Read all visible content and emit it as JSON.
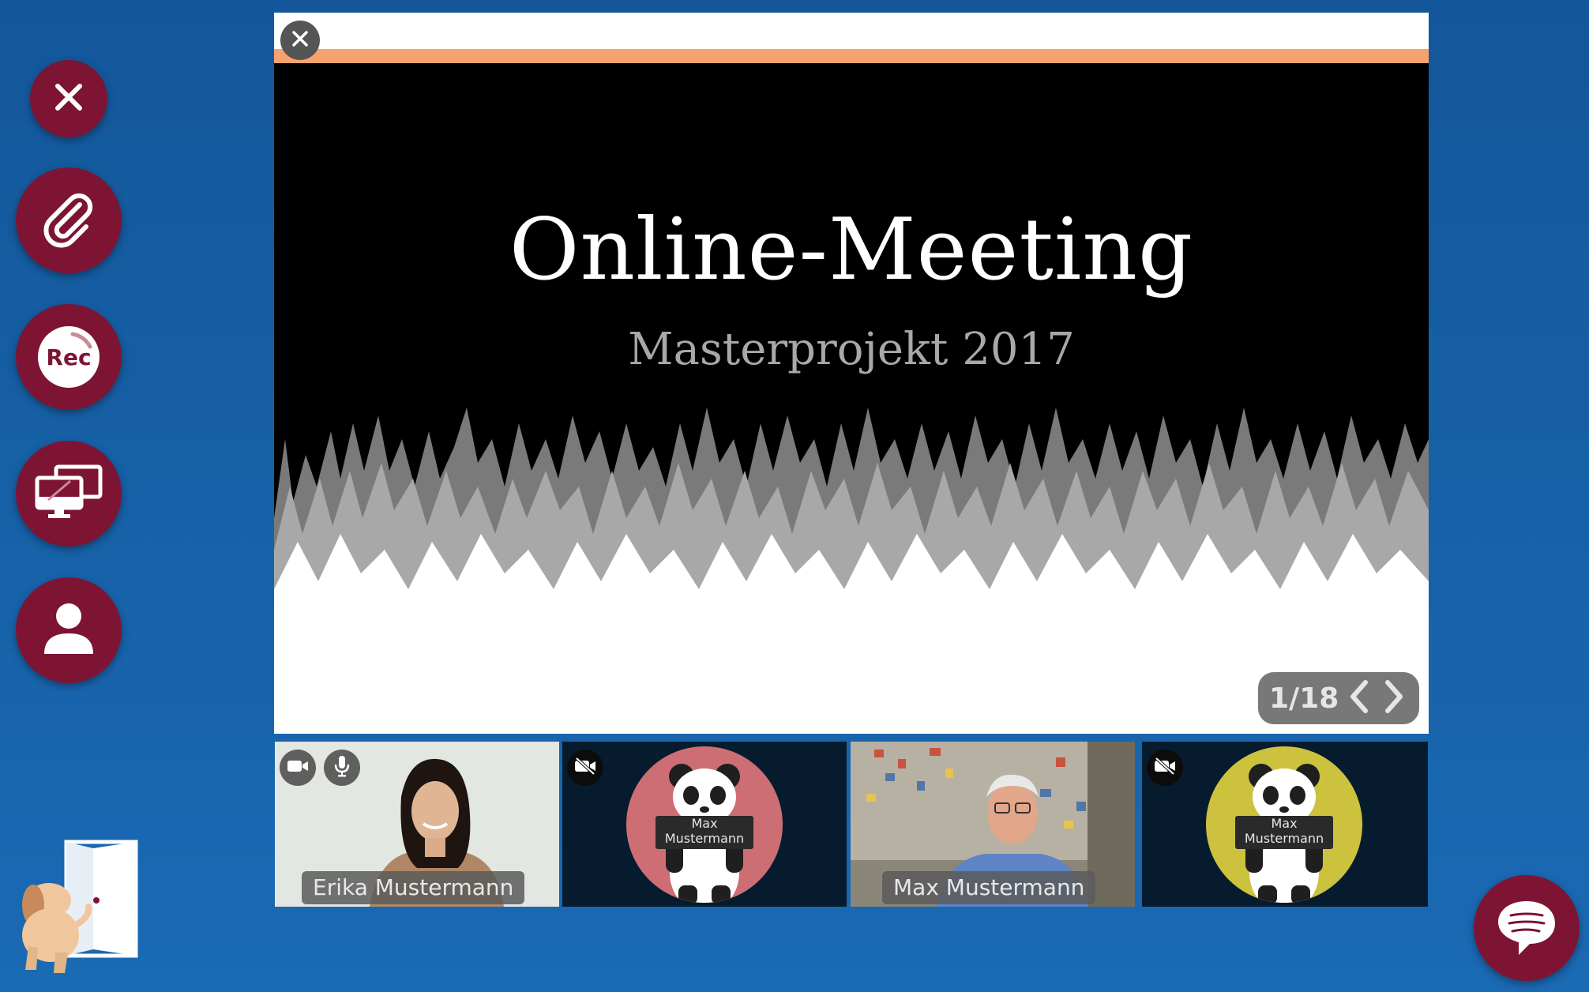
{
  "toolbar": {
    "items": [
      {
        "name": "close",
        "icon": "close-icon"
      },
      {
        "name": "attachments",
        "icon": "paperclip-icon"
      },
      {
        "name": "record",
        "icon": "record-icon",
        "label": "Rec"
      },
      {
        "name": "screen-share",
        "icon": "monitors-icon"
      },
      {
        "name": "participants",
        "icon": "person-icon"
      }
    ]
  },
  "exit": {
    "icon": "dog-exit-door-icon"
  },
  "slide": {
    "title": "Online-Meeting",
    "subtitle": "Masterprojekt 2017",
    "page_indicator": "1/18",
    "accent_color": "#f7a36e"
  },
  "participants": [
    {
      "name": "Erika Mustermann",
      "type": "video",
      "camera": "on",
      "mic": "on"
    },
    {
      "name": "Max Mustermann",
      "type": "avatar",
      "camera": "off",
      "avatar_color": "#cd6e74"
    },
    {
      "name": "Max Mustermann",
      "type": "video",
      "camera": "on"
    },
    {
      "name": "Max Mustermann",
      "type": "avatar",
      "camera": "off",
      "avatar_color": "#ccc23e"
    }
  ],
  "colors": {
    "brand": "#7e1434",
    "background": "#13579a"
  },
  "chat": {
    "icon": "chat-bubble-icon"
  }
}
